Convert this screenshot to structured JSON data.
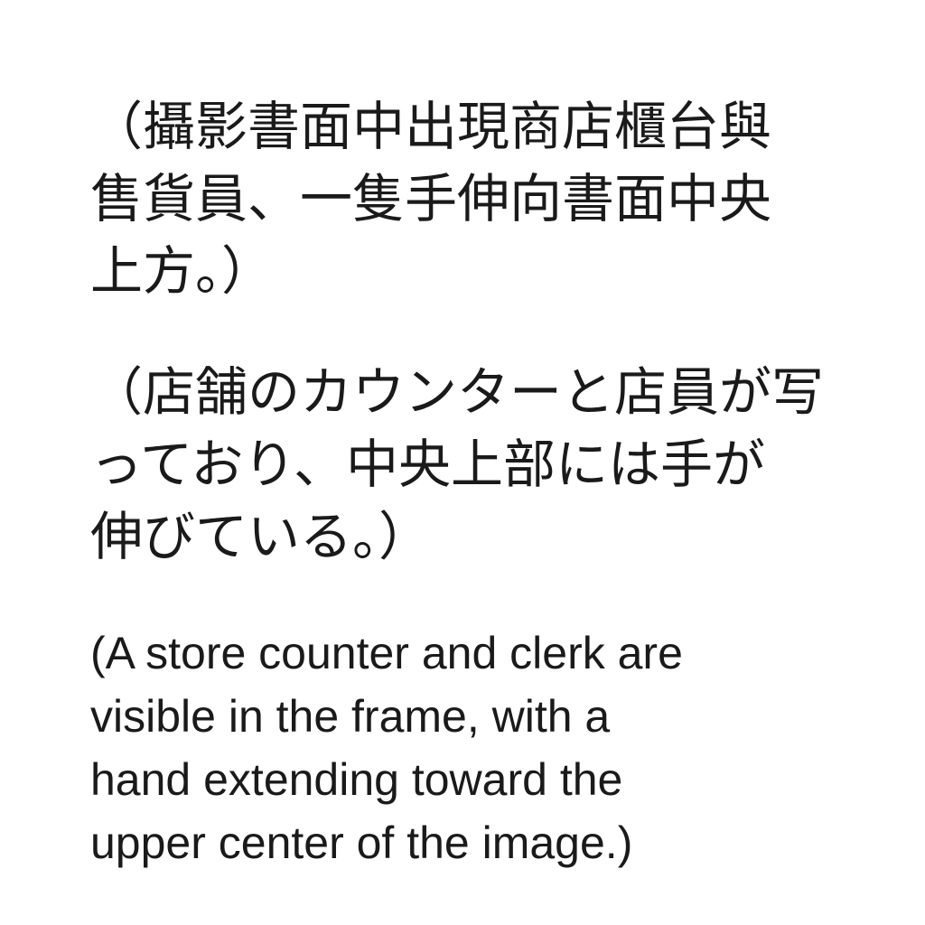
{
  "paragraphs": [
    {
      "lang": "zh-Hant",
      "lines": [
        "（攝影書面中出現商店櫃台與",
        "售貨員、一隻手伸向書面中央",
        "上方。）"
      ]
    },
    {
      "lang": "ja",
      "lines": [
        "（店舗のカウンターと店員が写",
        "っており、中央上部には手が",
        "伸びている。）"
      ]
    },
    {
      "lang": "en",
      "lines": [
        "(A store counter and clerk are",
        "visible in the frame, with a",
        "hand extending toward the",
        "upper center of the image.)"
      ]
    }
  ]
}
